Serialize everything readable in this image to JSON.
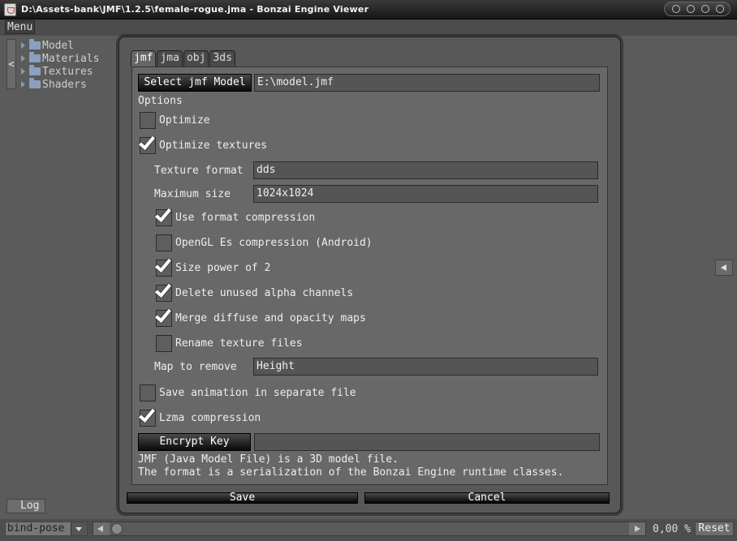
{
  "window": {
    "title": "D:\\Assets-bank\\JMF\\1.2.5\\female-rogue.jma - Bonzai Engine Viewer"
  },
  "menu": {
    "label": "Menu"
  },
  "sidebar": {
    "toggle_label": "<",
    "items": [
      {
        "label": "Model"
      },
      {
        "label": "Materials"
      },
      {
        "label": "Textures"
      },
      {
        "label": "Shaders"
      }
    ]
  },
  "bottom": {
    "log_label": "Log",
    "pose_value": "bind-pose",
    "zoom_value": "0,00 %",
    "reset_label": "Reset"
  },
  "dialog": {
    "tabs": [
      {
        "label": "jmf"
      },
      {
        "label": "jma"
      },
      {
        "label": "obj"
      },
      {
        "label": "3ds"
      }
    ],
    "select_model_label": "Select jmf Model",
    "model_path": "E:\\model.jmf",
    "options_label": "Options",
    "optimize_label": "Optimize",
    "optimize_checked": false,
    "optimize_textures_label": "Optimize textures",
    "optimize_textures_checked": true,
    "texture_format_label": "Texture format",
    "texture_format_value": "dds",
    "max_size_label": "Maximum size",
    "max_size_value": "1024x1024",
    "texture_options": [
      {
        "label": "Use format compression",
        "checked": true
      },
      {
        "label": "OpenGL Es compression (Android)",
        "checked": false
      },
      {
        "label": "Size power of 2",
        "checked": true
      },
      {
        "label": "Delete unused alpha channels",
        "checked": true
      },
      {
        "label": "Merge diffuse and opacity maps",
        "checked": true
      },
      {
        "label": "Rename texture files",
        "checked": false
      }
    ],
    "map_remove_label": "Map to remove",
    "map_remove_value": "Height",
    "save_anim_label": "Save animation in separate file",
    "save_anim_checked": false,
    "lzma_label": "Lzma compression",
    "lzma_checked": true,
    "encrypt_key_label": "Encrypt Key",
    "encrypt_key_value": "",
    "description_line1": "JMF (Java Model File) is a 3D model file.",
    "description_line2": "The format is a serialization of the Bonzai Engine runtime classes.",
    "save_label": "Save",
    "cancel_label": "Cancel"
  }
}
